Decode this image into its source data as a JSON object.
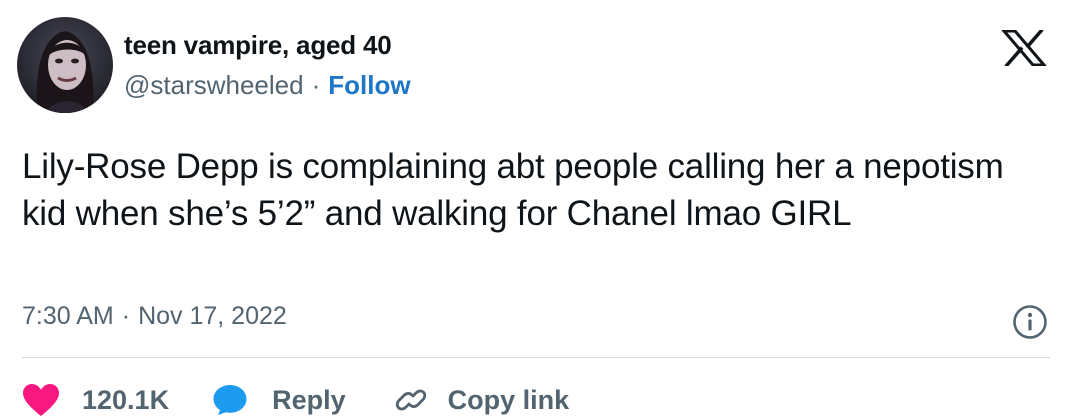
{
  "author": {
    "display_name": "teen vampire, aged 40",
    "handle": "@starswheeled",
    "separator": "·",
    "follow_label": "Follow"
  },
  "tweet": {
    "text": "Lily-Rose Depp is complaining abt people calling her a nepotism kid when she’s 5’2” and walking for Chanel lmao GIRL",
    "time": "7:30 AM",
    "separator": "·",
    "date": "Nov 17, 2022"
  },
  "actions": {
    "like_count": "120.1K",
    "reply_label": "Reply",
    "copy_link_label": "Copy link"
  },
  "icons": {
    "brand": "x-logo-icon",
    "info": "info-icon",
    "like": "heart-icon",
    "reply": "speech-bubble-icon",
    "copy": "link-icon"
  },
  "colors": {
    "text": "#0f1419",
    "secondary": "#536471",
    "follow": "#1d76c6",
    "heart": "#f91880",
    "reply_bubble": "#1d9bf0",
    "divider": "#d5dbe0"
  }
}
